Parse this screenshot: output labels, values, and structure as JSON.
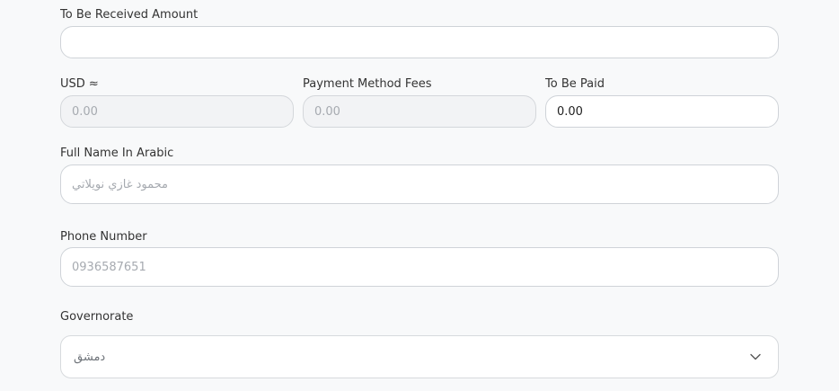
{
  "form": {
    "received_amount": {
      "label": "To Be Received Amount",
      "value": ""
    },
    "usd": {
      "label": "USD ≈",
      "placeholder": "0.00"
    },
    "fees": {
      "label": "Payment Method Fees",
      "placeholder": "0.00"
    },
    "to_be_paid": {
      "label": "To Be Paid",
      "value": "0.00"
    },
    "full_name": {
      "label": "Full Name In Arabic",
      "placeholder": "محمود غازي نويلاتي"
    },
    "phone": {
      "label": "Phone Number",
      "placeholder": "0936587651"
    },
    "governorate": {
      "label": "Governorate",
      "selected": "دمشق"
    }
  },
  "icons": {
    "dropdown": "chevron-down-icon"
  }
}
